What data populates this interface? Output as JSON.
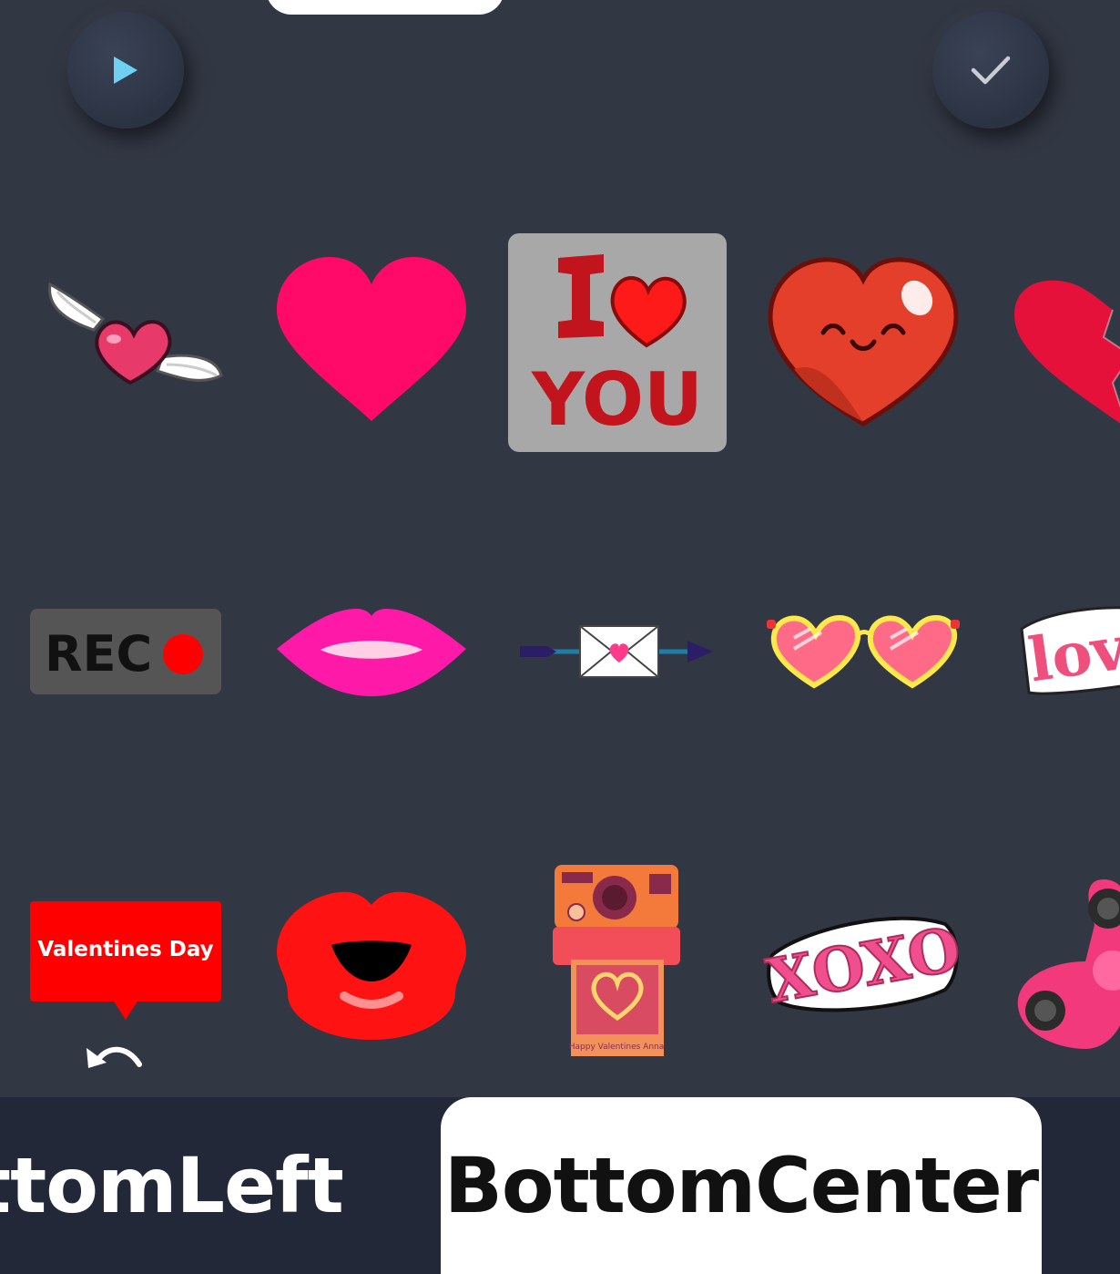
{
  "toolbar": {
    "play_icon": "play-icon",
    "confirm_icon": "checkmark-icon",
    "accent_play": "#6fd0f2",
    "accent_check": "#c9ccd2"
  },
  "stickers": {
    "selected_index": 2,
    "items": [
      {
        "name": "winged-heart",
        "row": 1
      },
      {
        "name": "pink-heart",
        "row": 1
      },
      {
        "name": "i-love-you",
        "text": "I YOU",
        "row": 1
      },
      {
        "name": "smiling-heart",
        "row": 1
      },
      {
        "name": "broken-heart",
        "row": 1
      },
      {
        "name": "rec",
        "text": "REC",
        "row": 2
      },
      {
        "name": "pink-lips",
        "row": 2
      },
      {
        "name": "love-letter-arrow",
        "row": 2
      },
      {
        "name": "heart-glasses",
        "row": 2
      },
      {
        "name": "love-badge",
        "text": "lov",
        "row": 2
      },
      {
        "name": "valentines-day-bubble",
        "text": "Valentines Day",
        "row": 3
      },
      {
        "name": "red-kiss-lips",
        "row": 3
      },
      {
        "name": "instant-camera",
        "text": "Happy Valentines Anna",
        "row": 3
      },
      {
        "name": "xoxo",
        "text": "XOXO",
        "row": 3
      },
      {
        "name": "fidget-spinner",
        "row": 3
      }
    ]
  },
  "tabs": {
    "left_label": "ttomLeft",
    "center_label": "BottomCenter",
    "active": "BottomCenter"
  }
}
